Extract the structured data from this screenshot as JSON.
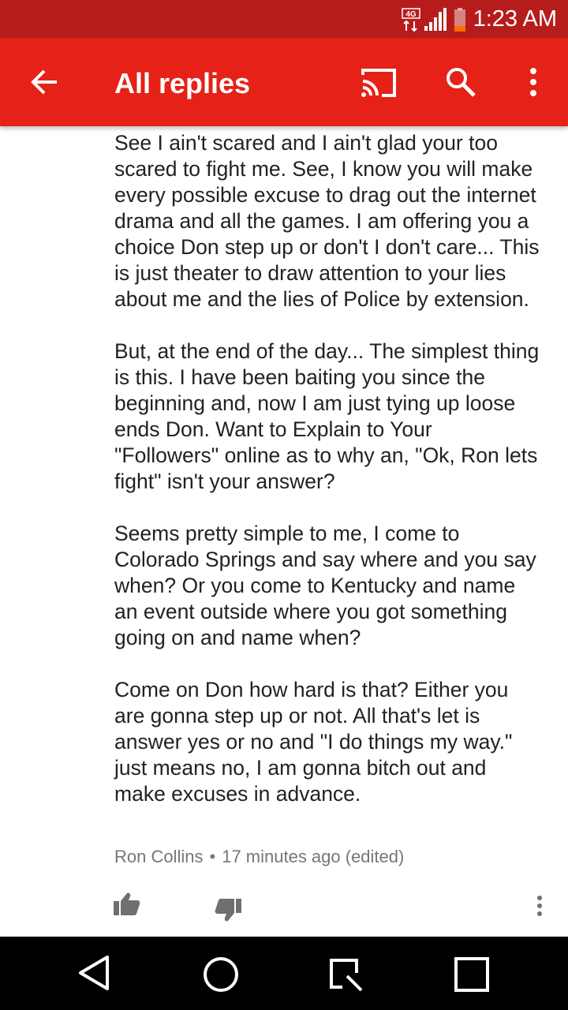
{
  "status_bar": {
    "time": "1:23 AM",
    "network": "4G",
    "icons": [
      "network-4g-icon",
      "signal-icon",
      "battery-low-icon"
    ],
    "battery_color": "#ff6d00"
  },
  "app_bar": {
    "title": "All replies",
    "background": "#e62117",
    "icons": [
      "back-arrow-icon",
      "cast-icon",
      "search-icon",
      "more-vert-icon"
    ]
  },
  "comment": {
    "paragraphs": [
      "See I ain't scared and I ain't glad your too scared to fight me. See, I know you will make every possible excuse to drag out the internet drama and all the games. I am offering you a choice Don step up or don't I don't care... This is just theater to draw attention to your lies about me and the lies of Police by extension.",
      "But, at the end of the day... The simplest thing is this. I have been baiting you since the beginning and, now I am just tying up loose ends Don. Want to Explain to Your \"Followers\" online as to why an, \"Ok, Ron lets fight\" isn't your answer?",
      "Seems pretty simple to me, I come to Colorado Springs and say where and you say when? Or you come to Kentucky and name an event outside where you got something going on and name when?",
      "Come on Don how hard is that? Either you are gonna step up or not. All that's let is answer yes or no and \"I do things my way.\" just means no, I am gonna bitch out and make excuses in advance."
    ],
    "author": "Ron Collins",
    "separator": "•",
    "timestamp": "17 minutes ago (edited)",
    "actions": [
      "thumb-up-icon",
      "thumb-down-icon",
      "more-vert-icon"
    ]
  },
  "nav_bar": {
    "buttons": [
      "back-triangle-icon",
      "home-circle-icon",
      "recents-square-icon",
      "overview-square-icon"
    ]
  }
}
